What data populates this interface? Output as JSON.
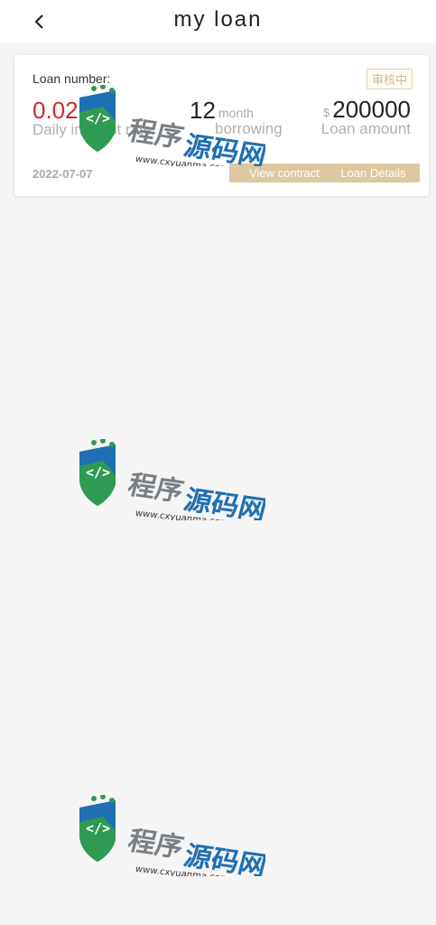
{
  "header": {
    "title": "my loan"
  },
  "loan": {
    "number_label": "Loan number:",
    "status": "审核中",
    "rate_value": "0.02",
    "rate_label": "Daily interest rate",
    "term_value": "12",
    "term_unit": "month",
    "term_label": "borrowing",
    "amount_currency": "$",
    "amount_value": "200000",
    "amount_label": "Loan amount",
    "date": "2022-07-07",
    "contract_button": "View contract",
    "details_button": "Loan Details"
  },
  "watermark": {
    "text": "程序源码网",
    "url": "www.cxyuanma.com"
  },
  "colors": {
    "accent_red": "#cf2a2a",
    "button_tan": "#dcc79f",
    "background": "#f5f5f5"
  }
}
